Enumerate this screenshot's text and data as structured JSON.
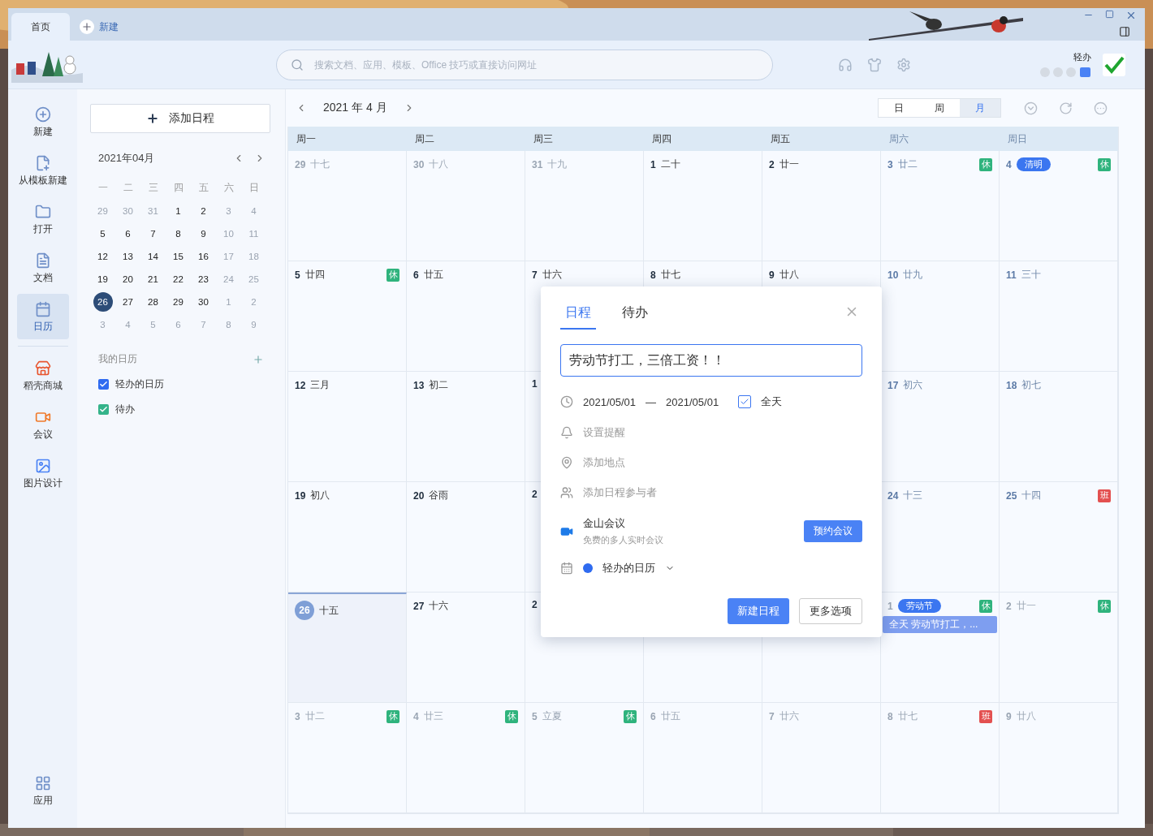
{
  "tabs": [
    {
      "label": "首页",
      "selected": true
    }
  ],
  "new_tab": "新建",
  "search": {
    "placeholder": "搜索文档、应用、模板、Office 技巧或直接访问网址"
  },
  "user": {
    "name": "轻办"
  },
  "sidebar": {
    "items": [
      {
        "kind": "new",
        "label": "新建",
        "selected": false
      },
      {
        "kind": "template",
        "label": "从模板新建",
        "selected": false
      },
      {
        "kind": "open",
        "label": "打开",
        "selected": false
      },
      {
        "kind": "doc",
        "label": "文档",
        "selected": false
      },
      {
        "kind": "calendar",
        "label": "日历",
        "selected": true
      },
      {
        "kind": "store",
        "label": "稻壳商城",
        "selected": false
      },
      {
        "kind": "meeting",
        "label": "会议",
        "selected": false
      },
      {
        "kind": "design",
        "label": "图片设计",
        "selected": false
      }
    ],
    "bottom": {
      "kind": "apps",
      "label": "应用"
    }
  },
  "add_button": "添加日程",
  "mini_calendar": {
    "title": "2021年04月",
    "weekdays": [
      "一",
      "二",
      "三",
      "四",
      "五",
      "六",
      "日"
    ],
    "weeks": [
      [
        {
          "day": "29",
          "muted": true,
          "selected": false
        },
        {
          "day": "30",
          "muted": true,
          "selected": false
        },
        {
          "day": "31",
          "muted": true,
          "selected": false
        },
        {
          "day": "1",
          "muted": false,
          "selected": false
        },
        {
          "day": "2",
          "muted": false,
          "selected": false
        },
        {
          "day": "3",
          "muted": true,
          "selected": false
        },
        {
          "day": "4",
          "muted": true,
          "selected": false
        }
      ],
      [
        {
          "day": "5",
          "muted": false,
          "selected": false
        },
        {
          "day": "6",
          "muted": false,
          "selected": false
        },
        {
          "day": "7",
          "muted": false,
          "selected": false
        },
        {
          "day": "8",
          "muted": false,
          "selected": false
        },
        {
          "day": "9",
          "muted": false,
          "selected": false
        },
        {
          "day": "10",
          "muted": true,
          "selected": false
        },
        {
          "day": "11",
          "muted": true,
          "selected": false
        }
      ],
      [
        {
          "day": "12",
          "muted": false,
          "selected": false
        },
        {
          "day": "13",
          "muted": false,
          "selected": false
        },
        {
          "day": "14",
          "muted": false,
          "selected": false
        },
        {
          "day": "15",
          "muted": false,
          "selected": false
        },
        {
          "day": "16",
          "muted": false,
          "selected": false
        },
        {
          "day": "17",
          "muted": true,
          "selected": false
        },
        {
          "day": "18",
          "muted": true,
          "selected": false
        }
      ],
      [
        {
          "day": "19",
          "muted": false,
          "selected": false
        },
        {
          "day": "20",
          "muted": false,
          "selected": false
        },
        {
          "day": "21",
          "muted": false,
          "selected": false
        },
        {
          "day": "22",
          "muted": false,
          "selected": false
        },
        {
          "day": "23",
          "muted": false,
          "selected": false
        },
        {
          "day": "24",
          "muted": true,
          "selected": false
        },
        {
          "day": "25",
          "muted": true,
          "selected": false
        }
      ],
      [
        {
          "day": "26",
          "muted": false,
          "selected": true
        },
        {
          "day": "27",
          "muted": false,
          "selected": false
        },
        {
          "day": "28",
          "muted": false,
          "selected": false
        },
        {
          "day": "29",
          "muted": false,
          "selected": false
        },
        {
          "day": "30",
          "muted": false,
          "selected": false
        },
        {
          "day": "1",
          "muted": true,
          "selected": false
        },
        {
          "day": "2",
          "muted": true,
          "selected": false
        }
      ],
      [
        {
          "day": "3",
          "muted": true,
          "selected": false
        },
        {
          "day": "4",
          "muted": true,
          "selected": false
        },
        {
          "day": "5",
          "muted": true,
          "selected": false
        },
        {
          "day": "6",
          "muted": true,
          "selected": false
        },
        {
          "day": "7",
          "muted": true,
          "selected": false
        },
        {
          "day": "8",
          "muted": true,
          "selected": false
        },
        {
          "day": "9",
          "muted": true,
          "selected": false
        }
      ]
    ]
  },
  "my_calendars": {
    "title": "我的日历",
    "items": [
      {
        "label": "轻办的日历",
        "checked": true,
        "color": "#2f6bf0"
      },
      {
        "label": "待办",
        "checked": true,
        "color": "#34b38a"
      }
    ]
  },
  "calendar": {
    "title": "2021 年 4 月",
    "views": [
      {
        "label": "日",
        "selected": false
      },
      {
        "label": "周",
        "selected": false
      },
      {
        "label": "月",
        "selected": true
      }
    ],
    "columns": [
      {
        "label": "周一",
        "weekend": false
      },
      {
        "label": "周二",
        "weekend": false
      },
      {
        "label": "周三",
        "weekend": false
      },
      {
        "label": "周四",
        "weekend": false
      },
      {
        "label": "周五",
        "weekend": false
      },
      {
        "label": "周六",
        "weekend": true
      },
      {
        "label": "周日",
        "weekend": true
      }
    ],
    "weeks": [
      [
        {
          "kind": "day",
          "day": "29",
          "lunar": "十七",
          "other_month": true
        },
        {
          "kind": "day",
          "day": "30",
          "lunar": "十八",
          "other_month": true
        },
        {
          "kind": "day",
          "day": "31",
          "lunar": "十九",
          "other_month": true
        },
        {
          "kind": "day",
          "day": "1",
          "lunar": "二十",
          "other_month": false,
          "weekend": false
        },
        {
          "kind": "day",
          "day": "2",
          "lunar": "廿一",
          "other_month": false,
          "weekend": false
        },
        {
          "kind": "day",
          "day": "3",
          "lunar": "廿二",
          "other_month": false,
          "weekend": true,
          "badge": {
            "text": "休",
            "kind": "rest"
          }
        },
        {
          "kind": "day",
          "day": "4",
          "holiday": "清明",
          "other_month": false,
          "weekend": true,
          "badge": {
            "text": "休",
            "kind": "rest"
          }
        }
      ],
      [
        {
          "kind": "day",
          "day": "5",
          "lunar": "廿四",
          "other_month": false,
          "weekend": false,
          "badge": {
            "text": "休",
            "kind": "rest"
          }
        },
        {
          "kind": "day",
          "day": "6",
          "lunar": "廿五",
          "other_month": false,
          "weekend": false
        },
        {
          "kind": "day",
          "day": "7",
          "lunar": "廿六",
          "other_month": false,
          "weekend": false
        },
        {
          "kind": "day",
          "day": "8",
          "lunar": "廿七",
          "other_month": false,
          "weekend": false
        },
        {
          "kind": "day",
          "day": "9",
          "lunar": "廿八",
          "other_month": false,
          "weekend": false
        },
        {
          "kind": "day",
          "day": "10",
          "lunar": "廿九",
          "other_month": false,
          "weekend": true
        },
        {
          "kind": "day",
          "day": "11",
          "lunar": "三十",
          "other_month": false,
          "weekend": true
        }
      ],
      [
        {
          "kind": "day",
          "day": "12",
          "lunar": "三月",
          "other_month": false,
          "weekend": false
        },
        {
          "kind": "day",
          "day": "13",
          "lunar": "初二",
          "other_month": false,
          "weekend": false
        },
        {
          "kind": "day",
          "day": "1",
          "other_month": false,
          "weekend": false
        },
        {
          "kind": "empty"
        },
        {
          "kind": "empty"
        },
        {
          "kind": "day",
          "day": "17",
          "lunar": "初六",
          "other_month": false,
          "weekend": true
        },
        {
          "kind": "day",
          "day": "18",
          "lunar": "初七",
          "other_month": false,
          "weekend": true
        }
      ],
      [
        {
          "kind": "day",
          "day": "19",
          "lunar": "初八",
          "other_month": false,
          "weekend": false
        },
        {
          "kind": "day",
          "day": "20",
          "lunar": "谷雨",
          "other_month": false,
          "weekend": false
        },
        {
          "kind": "day",
          "day": "2",
          "other_month": false,
          "weekend": false
        },
        {
          "kind": "empty"
        },
        {
          "kind": "empty"
        },
        {
          "kind": "day",
          "day": "24",
          "lunar": "十三",
          "other_month": false,
          "weekend": true
        },
        {
          "kind": "day",
          "day": "25",
          "lunar": "十四",
          "other_month": false,
          "weekend": true,
          "badge": {
            "text": "班",
            "kind": "work"
          }
        }
      ],
      [
        {
          "kind": "day",
          "day": "26",
          "lunar": "十五",
          "today": true
        },
        {
          "kind": "day",
          "day": "27",
          "lunar": "十六",
          "other_month": false,
          "weekend": false
        },
        {
          "kind": "day",
          "day": "2",
          "other_month": false,
          "weekend": false
        },
        {
          "kind": "blank"
        },
        {
          "kind": "blank"
        },
        {
          "kind": "day",
          "day": "1",
          "holiday": "劳动节",
          "other_month": true,
          "badge": {
            "text": "休",
            "kind": "rest"
          },
          "event": "全天 劳动节打工，..."
        },
        {
          "kind": "day",
          "day": "2",
          "lunar": "廿一",
          "other_month": true,
          "badge": {
            "text": "休",
            "kind": "rest"
          }
        }
      ],
      [
        {
          "kind": "day",
          "day": "3",
          "lunar": "廿二",
          "other_month": true,
          "badge": {
            "text": "休",
            "kind": "rest"
          }
        },
        {
          "kind": "day",
          "day": "4",
          "lunar": "廿三",
          "other_month": true,
          "badge": {
            "text": "休",
            "kind": "rest"
          }
        },
        {
          "kind": "day",
          "day": "5",
          "lunar": "立夏",
          "other_month": true,
          "badge": {
            "text": "休",
            "kind": "rest"
          }
        },
        {
          "kind": "day",
          "day": "6",
          "lunar": "廿五",
          "other_month": true
        },
        {
          "kind": "day",
          "day": "7",
          "lunar": "廿六",
          "other_month": true
        },
        {
          "kind": "day",
          "day": "8",
          "lunar": "廿七",
          "other_month": true,
          "badge": {
            "text": "班",
            "kind": "work"
          }
        },
        {
          "kind": "day",
          "day": "9",
          "lunar": "廿八",
          "other_month": true
        }
      ]
    ]
  },
  "popup": {
    "tabs": [
      {
        "label": "日程",
        "selected": true
      },
      {
        "label": "待办",
        "selected": false
      }
    ],
    "title_value": "劳动节打工，三倍工资！！",
    "start": "2021/05/01",
    "dash": "—",
    "end": "2021/05/01",
    "all_day": {
      "label": "全天",
      "checked": true
    },
    "options": [
      {
        "kind": "bell",
        "label": "设置提醒"
      },
      {
        "kind": "pin",
        "label": "添加地点"
      },
      {
        "kind": "people",
        "label": "添加日程参与者"
      }
    ],
    "meeting": {
      "title": "金山会议",
      "subtitle": "免费的多人实时会议",
      "button": "预约会议"
    },
    "calendar_select": {
      "label": "轻办的日历",
      "color": "#2f6bf0"
    },
    "primary_button": "新建日程",
    "secondary_button": "更多选项"
  }
}
